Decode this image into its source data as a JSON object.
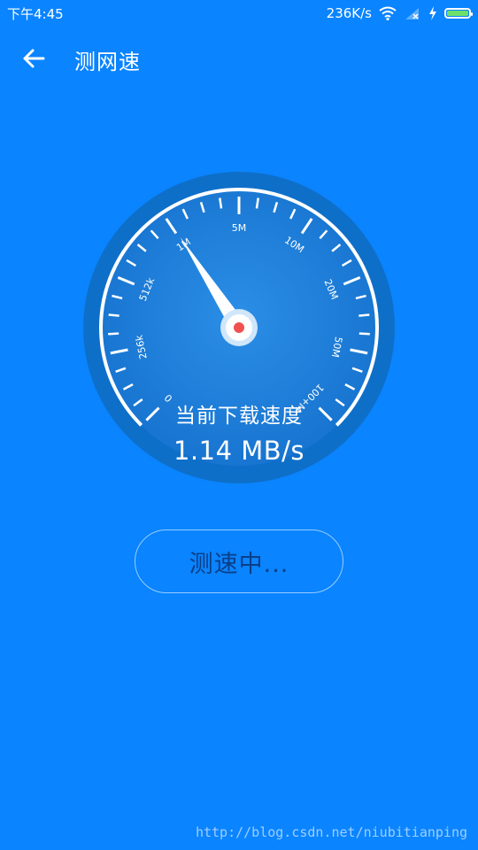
{
  "status_bar": {
    "time": "下午4:45",
    "network_speed": "236K/s",
    "icons": [
      "wifi-icon",
      "signal-icon",
      "charging-icon",
      "battery-icon"
    ]
  },
  "header": {
    "back_icon": "arrow-left-icon",
    "title": "测网速"
  },
  "gauge": {
    "scale_labels": [
      "0",
      "256k",
      "512k",
      "1M",
      "5M",
      "10M",
      "20M",
      "50M",
      "100+M"
    ],
    "needle_position": "1M",
    "label": "当前下载速度",
    "speed": "1.14 MB/s"
  },
  "action_button": {
    "label": "测速中..."
  },
  "watermark": "http://blog.csdn.net/niubitianping",
  "colors": {
    "background": "#0a84ff",
    "dial_face": "#1f7ed9",
    "dial_rim": "#0e6fc9",
    "needle_dot": "#f0514f",
    "battery": "#6ee06a",
    "button_text": "#0a3f87"
  }
}
